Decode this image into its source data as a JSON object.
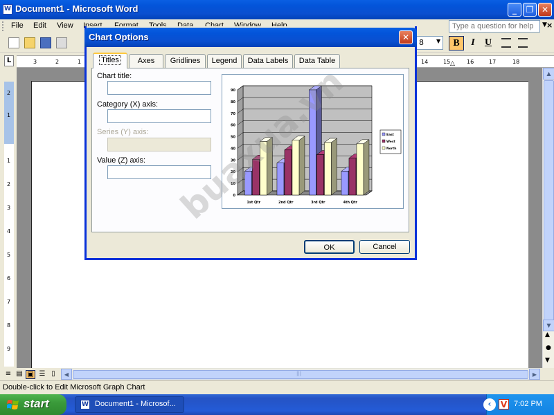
{
  "window": {
    "title": "Document1 - Microsoft Word",
    "app_icon": "W",
    "minimize_icon": "_",
    "restore_icon": "❐",
    "close_icon": "✕"
  },
  "menubar": {
    "items": [
      "File",
      "Edit",
      "View",
      "Insert",
      "Format",
      "Tools",
      "Data",
      "Chart",
      "Window",
      "Help"
    ],
    "ask_placeholder": "Type a question for help",
    "ask_arrow": "▼",
    "close_doc": "×"
  },
  "toolbar": {
    "font_size": "8",
    "bold": "B",
    "italic": "I",
    "underline": "U"
  },
  "ruler": {
    "corner": "L",
    "h_numbers": [
      "3",
      "2",
      "1",
      "14",
      "15",
      "16",
      "17",
      "18"
    ],
    "v_numbers": [
      "2",
      "1",
      "1",
      "2",
      "3",
      "4",
      "5",
      "6",
      "7",
      "8",
      "9"
    ]
  },
  "scroll": {
    "up": "▲",
    "down": "▼",
    "left": "◀",
    "right": "▶",
    "prev_page": "▲",
    "select_browse": "●",
    "next_page": "▼",
    "grip": "|||"
  },
  "status": {
    "text": "Double-click to Edit Microsoft Graph Chart"
  },
  "taskbar": {
    "start_label": "start",
    "task_label": "Document1 - Microsof...",
    "task_icon": "W",
    "clock": "7:02 PM",
    "tray_chevron": "‹",
    "tray_app": "V"
  },
  "dialog": {
    "title": "Chart Options",
    "close_icon": "✕",
    "tabs": [
      "Titles",
      "Axes",
      "Gridlines",
      "Legend",
      "Data Labels",
      "Data Table"
    ],
    "active_tab": "Titles",
    "fields": {
      "chart_title_label": "Chart title:",
      "category_label": "Category (X) axis:",
      "series_label": "Series (Y) axis:",
      "value_label": "Value (Z) axis:",
      "chart_title_value": "",
      "category_value": "",
      "series_value": "",
      "value_value": ""
    },
    "ok_label": "OK",
    "cancel_label": "Cancel"
  },
  "watermark": "buaxua.vn",
  "chart_data": {
    "type": "bar",
    "categories": [
      "1st Qtr",
      "2nd Qtr",
      "3rd Qtr",
      "4th Qtr"
    ],
    "series": [
      {
        "name": "East",
        "values": [
          20.4,
          27.4,
          90,
          20.4
        ],
        "color": "#9999ff"
      },
      {
        "name": "West",
        "values": [
          30.6,
          38.6,
          34.6,
          31.6
        ],
        "color": "#993366"
      },
      {
        "name": "North",
        "values": [
          45.9,
          46.9,
          45,
          43.9
        ],
        "color": "#ffffcc"
      }
    ],
    "ylim": [
      0,
      90
    ],
    "y_ticks": [
      0,
      10,
      20,
      30,
      40,
      50,
      60,
      70,
      80,
      90
    ],
    "grid": true,
    "legend_position": "right",
    "wall_color": "#c0c0c0",
    "title": "",
    "xlabel": "",
    "ylabel": ""
  }
}
